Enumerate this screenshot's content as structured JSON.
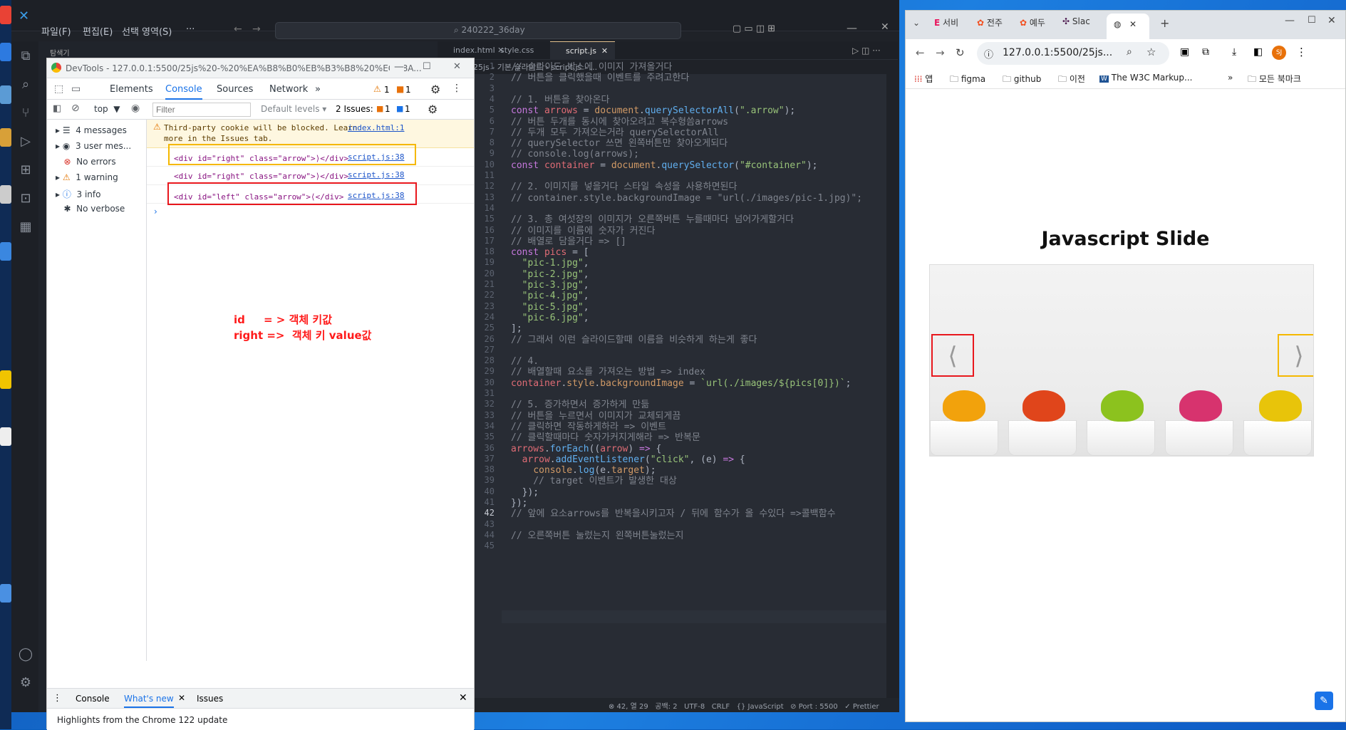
{
  "desktop": {
    "left_labels": [
      "탐색기"
    ]
  },
  "vscode": {
    "menu": [
      "파일(F)",
      "편집(E)",
      "선택 영역(S)",
      "···"
    ],
    "search_text": "240222_36day",
    "tabs": [
      "index.html",
      "style.css",
      "script.js"
    ],
    "breadcrumb": "25js - 기본 슬라이드 › script.js › ...",
    "code": [
      {
        "n": "1",
        "t": "// 슬라이드 박스에 이미지 가져올거다"
      },
      {
        "n": "2",
        "t": "// 버튼을 클릭했을때 이벤트를 주려고한다"
      },
      {
        "n": "3",
        "t": ""
      },
      {
        "n": "4",
        "t": "// 1. 버튼을 찾아온다"
      },
      {
        "n": "5",
        "t": "const arrows = document.querySelectorAll(\".arrow\");"
      },
      {
        "n": "6",
        "t": "// 버튼 두개를 동시에 찾아오려고 복수형씀arrows"
      },
      {
        "n": "7",
        "t": "// 두개 모두 가져오는거라 querySelectorAll"
      },
      {
        "n": "8",
        "t": "// querySelector 쓰면 왼쪽버튼만 찾아오게되다"
      },
      {
        "n": "9",
        "t": "// console.log(arrows);"
      },
      {
        "n": "10",
        "t": "const container = document.querySelector(\"#container\");"
      },
      {
        "n": "11",
        "t": ""
      },
      {
        "n": "12",
        "t": "// 2. 이미지를 넣을거다 스타일 속성을 사용하면된다"
      },
      {
        "n": "13",
        "t": "// container.style.backgroundImage = \"url(./images/pic-1.jpg)\";"
      },
      {
        "n": "14",
        "t": ""
      },
      {
        "n": "15",
        "t": "// 3. 총 여섯장의 이미지가 오른쪽버튼 누를때마다 넘어가게할거다"
      },
      {
        "n": "16",
        "t": "// 이미지를 이름에 숫자가 커진다"
      },
      {
        "n": "17",
        "t": "// 배열로 담을거다 => []"
      },
      {
        "n": "18",
        "t": "const pics = ["
      },
      {
        "n": "19",
        "t": "  \"pic-1.jpg\","
      },
      {
        "n": "20",
        "t": "  \"pic-2.jpg\","
      },
      {
        "n": "21",
        "t": "  \"pic-3.jpg\","
      },
      {
        "n": "22",
        "t": "  \"pic-4.jpg\","
      },
      {
        "n": "23",
        "t": "  \"pic-5.jpg\","
      },
      {
        "n": "24",
        "t": "  \"pic-6.jpg\","
      },
      {
        "n": "25",
        "t": "];"
      },
      {
        "n": "26",
        "t": "// 그래서 이런 슬라이드할때 이름을 비슷하게 하는게 좋다"
      },
      {
        "n": "27",
        "t": ""
      },
      {
        "n": "28",
        "t": "// 4."
      },
      {
        "n": "29",
        "t": "// 배열할때 요소를 가져오는 방법 => index"
      },
      {
        "n": "30",
        "t": "container.style.backgroundImage = `url(./images/${pics[0]})`;"
      },
      {
        "n": "31",
        "t": ""
      },
      {
        "n": "32",
        "t": "// 5. 증가하면서 증가하게 만듦"
      },
      {
        "n": "33",
        "t": "// 버튼을 누르면서 이미지가 교체되게끔"
      },
      {
        "n": "34",
        "t": "// 클릭하면 작동하게하라 => 이벤트"
      },
      {
        "n": "35",
        "t": "// 클릭할때마다 숫자가커지게해라 => 반복문"
      },
      {
        "n": "36",
        "t": "arrows.forEach((arrow) => {"
      },
      {
        "n": "37",
        "t": "  arrow.addEventListener(\"click\", (e) => {"
      },
      {
        "n": "38",
        "t": "    console.log(e.target);"
      },
      {
        "n": "39",
        "t": "    // target 이벤트가 발생한 대상"
      },
      {
        "n": "40",
        "t": "  });"
      },
      {
        "n": "41",
        "t": "});"
      },
      {
        "n": "42",
        "t": "// 앞에 요소arrows를 반복을시키고자 / 뒤에 함수가 올 수있다 =>콜백함수"
      },
      {
        "n": "43",
        "t": ""
      },
      {
        "n": "44",
        "t": "// 오른쪽버튼 눌렀는지 왼쪽버튼눌렀는지"
      },
      {
        "n": "45",
        "t": ""
      }
    ],
    "status": "⊗ 42, 열 29   공백: 2   UTF-8   CRLF   {} JavaScript   ⊘ Port : 5500   ✓ Prettier"
  },
  "devtools": {
    "title": "DevTools - 127.0.0.1:5500/25js%20-%20%EA%B8%B0%EB%B3%B8%20%EC%8A...",
    "tabs": [
      "Elements",
      "Console",
      "Sources",
      "Network"
    ],
    "warn_count": "1",
    "err_count": "1",
    "context": "top",
    "filter_placeholder": "Filter",
    "levels": "Default levels",
    "issues": "2 Issues:",
    "issues_err": "1",
    "issues_info": "1",
    "side": [
      {
        "label": "4 messages",
        "icon": "list-icon"
      },
      {
        "label": "3 user mes...",
        "icon": "user-icon"
      },
      {
        "label": "No errors",
        "icon": "error-icon"
      },
      {
        "label": "1 warning",
        "icon": "warning-icon"
      },
      {
        "label": "3 info",
        "icon": "info-icon"
      },
      {
        "label": "No verbose",
        "icon": "bug-icon"
      }
    ],
    "warning_text_1": "Third-party cookie will be blocked. Learn",
    "warning_text_2": "more in the Issues tab.",
    "warning_link": "index.html:1",
    "messages": [
      {
        "text": "<div id=\"right\" class=\"arrow\">⟩</div>",
        "link": "script.js:38"
      },
      {
        "text": "<div id=\"right\" class=\"arrow\">⟩</div>",
        "link": "script.js:38"
      },
      {
        "text": "<div id=\"left\" class=\"arrow\">⟨</div>",
        "link": "script.js:38"
      }
    ],
    "annotation_1": "id     = > 객체 키값",
    "annotation_2": "right =>  객체 키 value값",
    "drawer_tabs": [
      "Console",
      "What's new",
      "Issues"
    ],
    "drawer_text": "Highlights from the Chrome 122 update"
  },
  "chrome": {
    "tabs": [
      "서비",
      "전주",
      "예두",
      "Slac"
    ],
    "url": "127.0.0.1:5500/25js...",
    "bookmarks": [
      "앱",
      "figma",
      "github",
      "이전",
      "The W3C Markup...",
      "모든 북마크"
    ],
    "slide_title": "Javascript Slide",
    "left_arrow": "⟨",
    "right_arrow": "⟩",
    "profile_initials": "SJ"
  }
}
